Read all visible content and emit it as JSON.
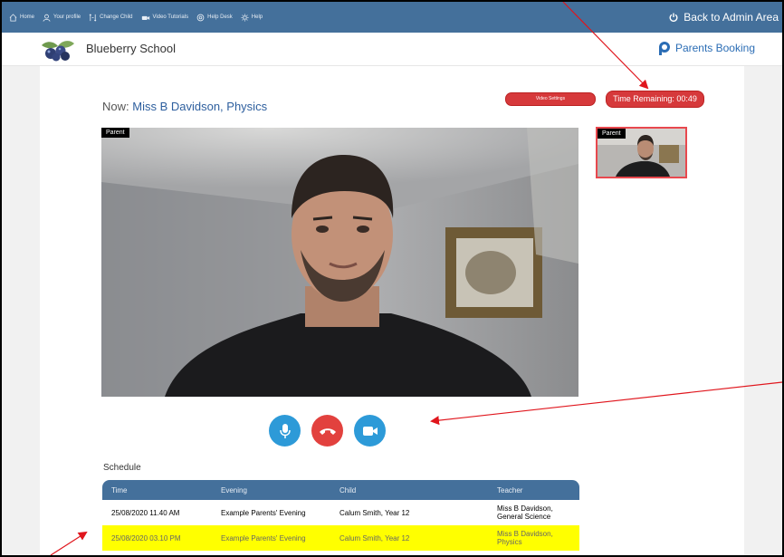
{
  "topnav": {
    "items": [
      {
        "label": "Home",
        "icon": "home-icon"
      },
      {
        "label": "Your profile",
        "icon": "user-icon"
      },
      {
        "label": "Change Child",
        "icon": "switch-icon"
      },
      {
        "label": "Video Tutorials",
        "icon": "video-icon"
      },
      {
        "label": "Help Desk",
        "icon": "lifebuoy-icon"
      },
      {
        "label": "Help",
        "icon": "gear-icon"
      }
    ],
    "back_label": "Back to Admin Area",
    "bg_color": "#44709b"
  },
  "header": {
    "school_name": "Blueberry School",
    "brand_name": "Parents Booking",
    "brand_color": "#2b6db5"
  },
  "meeting": {
    "now_prefix": "Now:",
    "now_value": "Miss B Davidson, Physics",
    "video_settings_label": "Video Settings",
    "time_remaining_label": "Time Remaining: 00:49",
    "main_video_label": "Parent",
    "thumb_video_label": "Parent",
    "button_color": "#d6393b"
  },
  "controls": {
    "mic_icon": "microphone-icon",
    "end_icon": "hang-up-icon",
    "camera_icon": "camera-icon"
  },
  "schedule": {
    "title": "Schedule",
    "columns": [
      "Time",
      "Evening",
      "Child",
      "Teacher"
    ],
    "rows": [
      {
        "time": "25/08/2020 11.40 AM",
        "evening": "Example Parents' Evening",
        "child": "Calum Smith, Year 12",
        "teacher_line1": "Miss B Davidson,",
        "teacher_line2": "General Science"
      },
      {
        "time": "25/08/2020 03.10 PM",
        "evening": "Example Parents' Evening",
        "child": "Calum Smith, Year 12",
        "teacher_line1": "Miss B Davidson,",
        "teacher_line2": "Physics"
      }
    ],
    "highlight_color": "#ffff00"
  }
}
